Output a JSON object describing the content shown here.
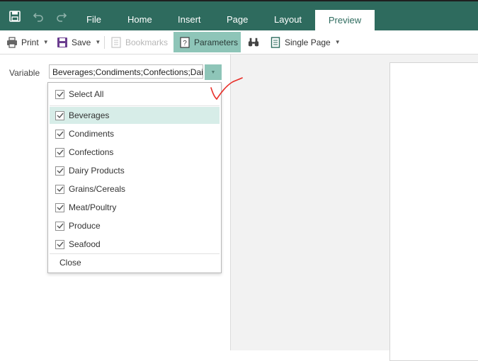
{
  "menu": {
    "tabs": [
      "File",
      "Home",
      "Insert",
      "Page",
      "Layout",
      "Preview"
    ],
    "active_tab": "Preview"
  },
  "toolbar": {
    "print_label": "Print",
    "save_label": "Save",
    "bookmarks_label": "Bookmarks",
    "parameters_label": "Parameters",
    "single_page_label": "Single Page"
  },
  "parameters": {
    "label": "Variable",
    "value": "Beverages;Condiments;Confections;Dairy Products;Grains/Cereals;Meat/Poultry;Produce;Seafood"
  },
  "dropdown": {
    "select_all_label": "Select All",
    "items": [
      {
        "label": "Beverages",
        "checked": true
      },
      {
        "label": "Condiments",
        "checked": true
      },
      {
        "label": "Confections",
        "checked": true
      },
      {
        "label": "Dairy Products",
        "checked": true
      },
      {
        "label": "Grains/Cereals",
        "checked": true
      },
      {
        "label": "Meat/Poultry",
        "checked": true
      },
      {
        "label": "Produce",
        "checked": true
      },
      {
        "label": "Seafood",
        "checked": true
      }
    ],
    "close_label": "Close"
  },
  "colors": {
    "ribbon": "#2e6b5e",
    "accent": "#8ec5b8",
    "highlight": "#d7ede8",
    "annotation": "#e8302a"
  }
}
